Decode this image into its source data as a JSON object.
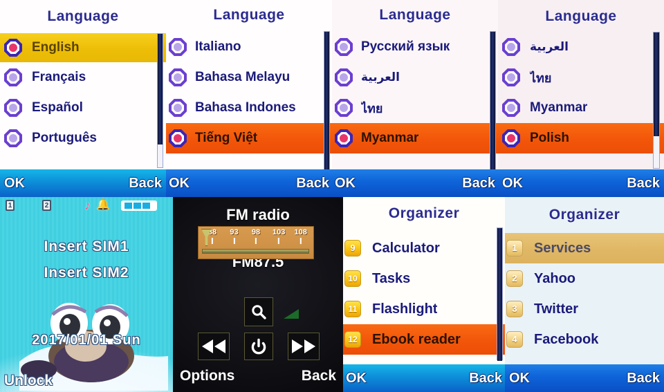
{
  "panels": [
    {
      "id": "language-1",
      "title": "Language",
      "items": [
        {
          "label": "English",
          "selected": true
        },
        {
          "label": "Français",
          "selected": false
        },
        {
          "label": "Español",
          "selected": false
        },
        {
          "label": "Português",
          "selected": false
        }
      ],
      "softkeys": {
        "left": "OK",
        "right": "Back"
      }
    },
    {
      "id": "language-2",
      "title": "Language",
      "items": [
        {
          "label": "Italiano",
          "selected": false
        },
        {
          "label": "Bahasa  Melayu",
          "selected": false
        },
        {
          "label": "Bahasa  Indones",
          "selected": false
        },
        {
          "label": "Tiếng  Việt",
          "selected": true
        }
      ],
      "softkeys": {
        "left": "OK",
        "right": "Back"
      }
    },
    {
      "id": "language-3",
      "title": "Language",
      "items": [
        {
          "label": "Русский  язык",
          "selected": false
        },
        {
          "label": "العربية",
          "selected": false
        },
        {
          "label": "ไทย",
          "selected": false
        },
        {
          "label": "Myanmar",
          "selected": true
        }
      ],
      "softkeys": {
        "left": "OK",
        "right": "Back"
      }
    },
    {
      "id": "language-4",
      "title": "Language",
      "items": [
        {
          "label": "العربية",
          "selected": false
        },
        {
          "label": "ไทย",
          "selected": false
        },
        {
          "label": "Myanmar",
          "selected": false
        },
        {
          "label": "Polish",
          "selected": true
        }
      ],
      "softkeys": {
        "left": "OK",
        "right": "Back"
      }
    }
  ],
  "home": {
    "status": {
      "sim1": "1",
      "sim2": "2",
      "music_icon": "music-note-icon",
      "alarm_icon": "bell-icon",
      "battery_bars": 3
    },
    "line1": "Insert  SIM1",
    "line2": "Insert  SIM2",
    "datetime": "2017/01/01  Sun",
    "softkeys": {
      "left": "Unlock",
      "right": ""
    }
  },
  "fm": {
    "title": "FM  radio",
    "scale_ticks": [
      "88",
      "93",
      "98",
      "103",
      "108"
    ],
    "frequency": "FM87.5",
    "buttons": [
      {
        "name": "search-icon",
        "glyph": "search"
      },
      {
        "name": "power-icon",
        "glyph": "power"
      },
      {
        "name": "rewind-icon",
        "glyph": "rewind"
      },
      {
        "name": "forward-icon",
        "glyph": "forward"
      },
      {
        "name": "volume-icon",
        "glyph": "volume"
      }
    ],
    "softkeys": {
      "left": "Options",
      "right": "Back"
    }
  },
  "organizer1": {
    "title": "Organizer",
    "items": [
      {
        "num": "9",
        "label": "Calculator",
        "selected": false
      },
      {
        "num": "10",
        "label": "Tasks",
        "selected": false
      },
      {
        "num": "11",
        "label": "Flashlight",
        "selected": false
      },
      {
        "num": "12",
        "label": "Ebook  reader",
        "selected": true
      }
    ],
    "softkeys": {
      "left": "OK",
      "right": "Back"
    }
  },
  "organizer2": {
    "title": "Organizer",
    "items": [
      {
        "num": "1",
        "label": "Services",
        "selected": true
      },
      {
        "num": "2",
        "label": "Yahoo",
        "selected": false
      },
      {
        "num": "3",
        "label": "Twitter",
        "selected": false
      },
      {
        "num": "4",
        "label": "Facebook",
        "selected": false
      }
    ],
    "softkeys": {
      "left": "OK",
      "right": "Back"
    }
  },
  "colors": {
    "gold_highlight": "#edbe07",
    "orange_highlight": "#f2560a",
    "tan_highlight": "#e0b765",
    "title_blue": "#2b2b8f",
    "softkey_cyan": "#16b5e8",
    "softkey_blue": "#0a4fc4",
    "radio_purple": "#6a3fd0",
    "home_cyan": "#41cfe0",
    "dial_orange": "#cf9247"
  }
}
